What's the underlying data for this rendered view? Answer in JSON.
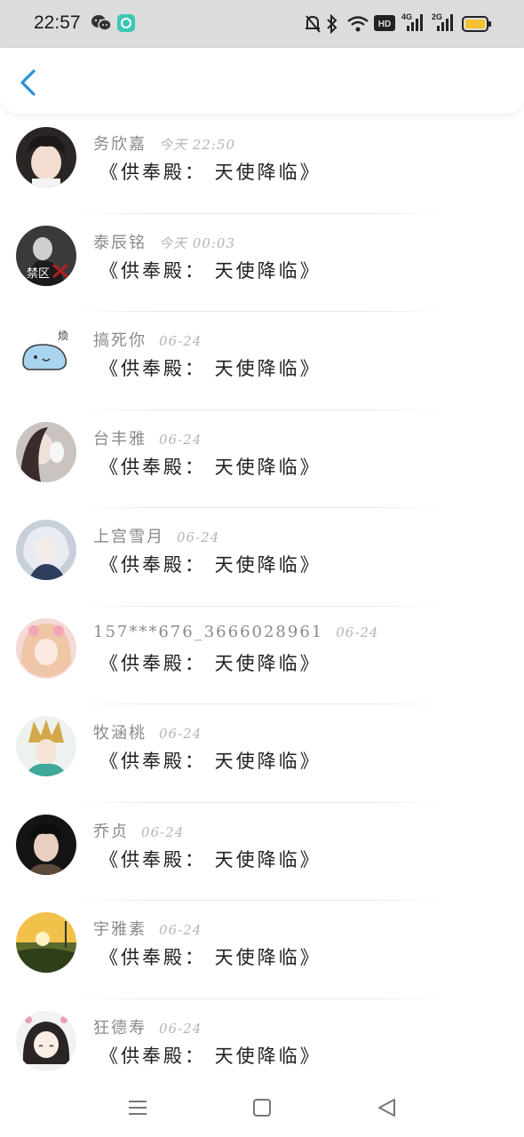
{
  "status_bar": {
    "time": "22:57",
    "icons": [
      "wechat-icon",
      "app-notification-icon",
      "mute-icon",
      "bluetooth-icon",
      "wifi-icon",
      "hd-icon",
      "signal-4g-icon",
      "signal-2g-icon",
      "battery-icon"
    ],
    "net1": "4G",
    "net2": "2G",
    "hd": "HD"
  },
  "header": {
    "back_icon": "chevron-left-icon",
    "accent": "#2a8fd8"
  },
  "messages": [
    {
      "name": "务欣嘉",
      "time": "今天 22:50",
      "text": "《供奉殿： 天使降临》"
    },
    {
      "name": "泰辰铭",
      "time": "今天 00:03",
      "text": "《供奉殿： 天使降临》",
      "avatar_label": "禁区"
    },
    {
      "name": "搞死你",
      "time": "06-24",
      "text": "《供奉殿： 天使降临》",
      "avatar_label": "烦"
    },
    {
      "name": "台丰雅",
      "time": "06-24",
      "text": "《供奉殿： 天使降临》"
    },
    {
      "name": "上宫雪月",
      "time": "06-24",
      "text": "《供奉殿： 天使降临》"
    },
    {
      "name": "157***676_3666028961",
      "time": "06-24",
      "text": "《供奉殿： 天使降临》"
    },
    {
      "name": "牧涵桃",
      "time": "06-24",
      "text": "《供奉殿： 天使降临》"
    },
    {
      "name": "乔贞",
      "time": "06-24",
      "text": "《供奉殿： 天使降临》"
    },
    {
      "name": "宇雅素",
      "time": "06-24",
      "text": "《供奉殿： 天使降临》"
    },
    {
      "name": "狂德寿",
      "time": "06-24",
      "text": "《供奉殿： 天使降临》"
    }
  ],
  "nav_bar": {
    "icons": [
      "menu-icon",
      "home-square-icon",
      "back-triangle-icon"
    ]
  }
}
